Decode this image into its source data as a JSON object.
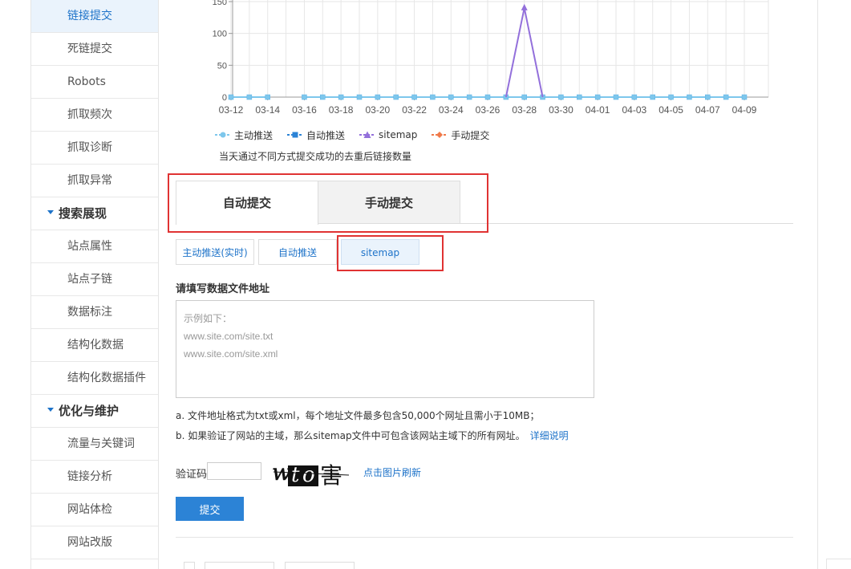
{
  "sidebar": {
    "items": [
      {
        "label": "链接提交",
        "type": "item",
        "active": true
      },
      {
        "label": "死链提交",
        "type": "item"
      },
      {
        "label": "Robots",
        "type": "item"
      },
      {
        "label": "抓取频次",
        "type": "item"
      },
      {
        "label": "抓取诊断",
        "type": "item"
      },
      {
        "label": "抓取异常",
        "type": "item"
      },
      {
        "label": "搜索展现",
        "type": "group"
      },
      {
        "label": "站点属性",
        "type": "item"
      },
      {
        "label": "站点子链",
        "type": "item"
      },
      {
        "label": "数据标注",
        "type": "item"
      },
      {
        "label": "结构化数据",
        "type": "item"
      },
      {
        "label": "结构化数据插件",
        "type": "item"
      },
      {
        "label": "优化与维护",
        "type": "group"
      },
      {
        "label": "流量与关键词",
        "type": "item"
      },
      {
        "label": "链接分析",
        "type": "item"
      },
      {
        "label": "网站体检",
        "type": "item"
      },
      {
        "label": "网站改版",
        "type": "item"
      }
    ]
  },
  "chart_data": {
    "type": "line",
    "x": [
      "03-12",
      "03-13",
      "03-14",
      "03-15",
      "03-16",
      "03-17",
      "03-18",
      "03-19",
      "03-20",
      "03-21",
      "03-22",
      "03-23",
      "03-24",
      "03-25",
      "03-26",
      "03-27",
      "03-28",
      "03-29",
      "03-30",
      "03-31",
      "04-01",
      "04-02",
      "04-03",
      "04-04",
      "04-05",
      "04-06",
      "04-07",
      "04-08",
      "04-09"
    ],
    "x_tick_labels": [
      "03-12",
      "03-14",
      "03-16",
      "03-18",
      "03-20",
      "03-22",
      "03-24",
      "03-26",
      "03-28",
      "03-30",
      "04-01",
      "04-03",
      "04-05",
      "04-07",
      "04-09"
    ],
    "y_tick_labels": [
      "0",
      "50",
      "100",
      "150"
    ],
    "ylim": [
      0,
      150
    ],
    "grid": true,
    "series": [
      {
        "name": "主动推送",
        "color": "#7ec7ec",
        "marker": "circle",
        "values": [
          0,
          0,
          0,
          null,
          0,
          0,
          0,
          0,
          0,
          0,
          0,
          0,
          0,
          0,
          0,
          0,
          0,
          0,
          0,
          0,
          0,
          0,
          0,
          0,
          0,
          0,
          0,
          0,
          0
        ]
      },
      {
        "name": "自动推送",
        "color": "#2c83d6",
        "marker": "square",
        "values": []
      },
      {
        "name": "sitemap",
        "color": "#9370db",
        "marker": "triangle",
        "values": [
          null,
          null,
          null,
          null,
          null,
          null,
          null,
          null,
          null,
          null,
          null,
          null,
          null,
          null,
          null,
          0,
          140,
          0,
          null,
          null,
          null,
          null,
          null,
          null,
          null,
          null,
          null,
          null,
          null
        ]
      },
      {
        "name": "手动提交",
        "color": "#f07a4a",
        "marker": "diamond",
        "values": []
      }
    ],
    "caption": "当天通过不同方式提交成功的去重后链接数量"
  },
  "tabs": {
    "main": [
      "自动提交",
      "手动提交"
    ],
    "sub": [
      "主动推送(实时)",
      "自动推送",
      "sitemap"
    ]
  },
  "form": {
    "label": "请填写数据文件地址",
    "placeholder_lines": [
      "示例如下：",
      "www.site.com/site.txt",
      "www.site.com/site.xml"
    ],
    "note1": "a. 文件地址格式为txt或xml，每个地址文件最多包含50,000个网址且需小于10MB；",
    "note2": "b. 如果验证了网站的主域，那么sitemap文件中可包含该网站主域下的所有网址。",
    "note2_link": "详细说明",
    "captcha_label": "验证码",
    "captcha_text": "wto害",
    "refresh": "点击图片刷新",
    "submit": "提交"
  }
}
